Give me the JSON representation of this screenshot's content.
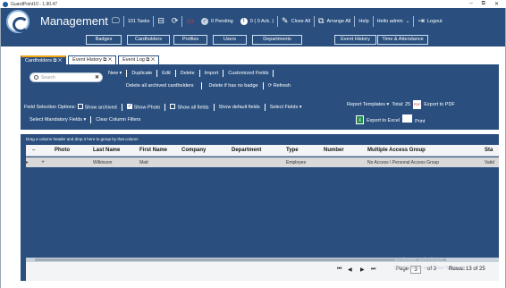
{
  "window": {
    "title": "GuardPoint10 - 1.90.47",
    "minimize": "–",
    "restore": "⧉",
    "close": "✕"
  },
  "topbar": {
    "app_title": "Management",
    "tasks_label": "101 Tasks",
    "pending_label": "0 Pending",
    "ack_label": "0 ( 0  Ack. )",
    "close_all": "Close All",
    "arrange_all": "Arrange All",
    "help": "Help",
    "hello": "Hello admin",
    "logout": "Logout"
  },
  "subnav": [
    "Badges",
    "Cardholders",
    "Profiles",
    "Users",
    "Departments",
    "Event History",
    "Time & Attendance"
  ],
  "tabs": [
    {
      "label": "Cardholders",
      "active": true
    },
    {
      "label": "Event History",
      "active": false
    },
    {
      "label": "Event Log",
      "active": false
    }
  ],
  "search": {
    "placeholder": "Search"
  },
  "actions": {
    "new": "New",
    "duplicate": "Duplicate",
    "edit": "Edit",
    "delete": "Delete",
    "import": "Import",
    "customized_fields": "Customized Fields",
    "delete_archived": "Delete all archived cardholders",
    "delete_no_badge": "Delete if has no badge",
    "refresh": "Refresh"
  },
  "options": {
    "field_selection": "Field Selection Options:",
    "show_archived": "Show archived",
    "show_photo": "Show Photo",
    "show_all_fields": "Show all fields",
    "show_default_fields": "Show default fields",
    "select_fields": "Select Fields",
    "report_templates": "Report Templates",
    "total": "Total: 25",
    "export_pdf": "Export to PDF",
    "select_mandatory": "Select Mandatory Fields",
    "clear_filters": "Clear Column Filters",
    "export_excel": "Export to Excel",
    "print": "Print"
  },
  "grid": {
    "drag_hint": "Drag a column header and drop it here to group by that column",
    "columns": [
      "Photo",
      "Last Name",
      "First Name",
      "Company",
      "Department",
      "Type",
      "Number",
      "Multiple Access Group",
      "Sta"
    ],
    "rows": [
      {
        "last": "Wilkinson",
        "first": "Matt",
        "company": "",
        "department": "",
        "type": "Employee",
        "number": "",
        "access": "No Access \\ Personal Access Group",
        "status": "Valid"
      }
    ]
  },
  "pager": {
    "page_label": "Page",
    "page": "3",
    "of": "of 3",
    "rows_label": "Rows:",
    "rows": "13 of 25"
  },
  "watermark": {
    "line1": "Activate Windows",
    "line2": "Go to Settings to activate Windows."
  }
}
